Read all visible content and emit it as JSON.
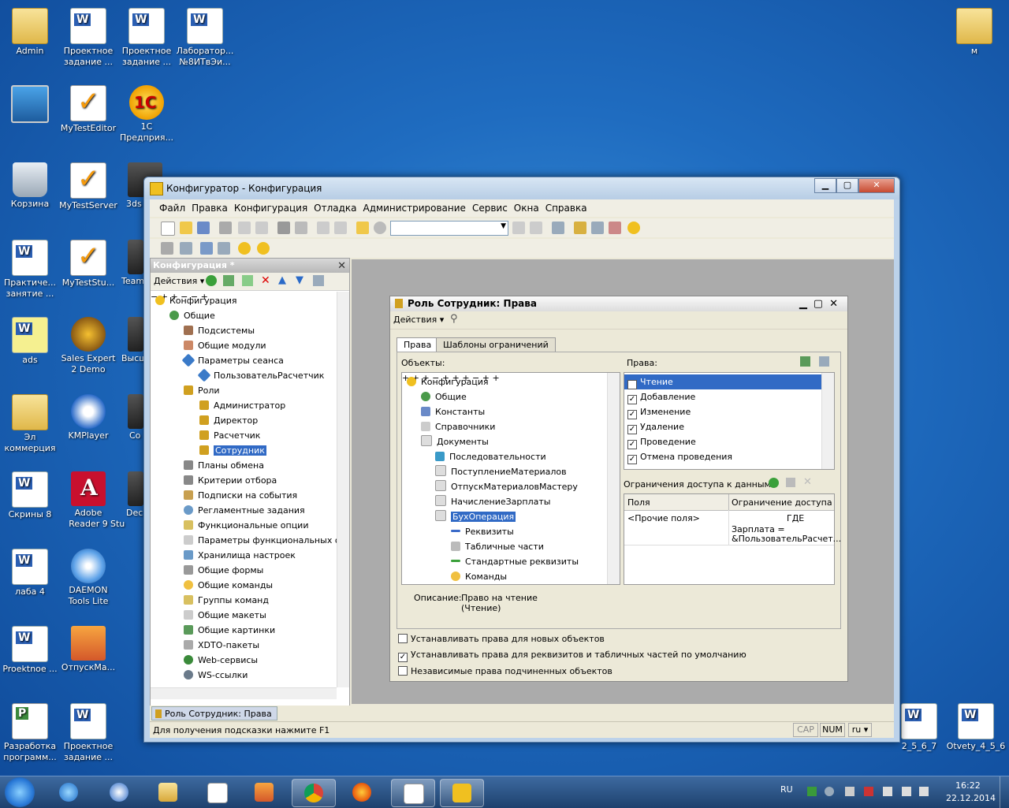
{
  "desktop": {
    "icons": [
      {
        "label": "Admin"
      },
      {
        "label": "Проектное задание ..."
      },
      {
        "label": "Проектное задание ..."
      },
      {
        "label": "Лаборатор... №8ИТвЭи..."
      },
      {
        "label": "м"
      },
      {
        "label": "MyTestEditor"
      },
      {
        "label": "1С Предприя..."
      },
      {
        "label": "Корзина"
      },
      {
        "label": "MyTestServer"
      },
      {
        "label": "3ds"
      },
      {
        "label": "Практиче... занятие ..."
      },
      {
        "label": "MyTestStu..."
      },
      {
        "label": "Team"
      },
      {
        "label": "ads"
      },
      {
        "label": "Sales Expert 2 Demo"
      },
      {
        "label": "Высш"
      },
      {
        "label": "Эл коммерция"
      },
      {
        "label": "KMPlayer"
      },
      {
        "label": "Co"
      },
      {
        "label": "Скрины 8"
      },
      {
        "label": "Adobe Reader 9"
      },
      {
        "label": "Dec Stu"
      },
      {
        "label": "лаба 4"
      },
      {
        "label": "DAEMON Tools Lite"
      },
      {
        "label": "Proektnoe ..."
      },
      {
        "label": "ОтпускМа..."
      },
      {
        "label": "Разработка программ..."
      },
      {
        "label": "Проектное задание ..."
      },
      {
        "label": "2_5_6_7"
      },
      {
        "label": "Otvety_4_5_6"
      }
    ]
  },
  "window": {
    "title": "Конфигуратор - Конфигурация",
    "menu": [
      "Файл",
      "Правка",
      "Конфигурация",
      "Отладка",
      "Администрирование",
      "Сервис",
      "Окна",
      "Справка"
    ]
  },
  "config_panel": {
    "title": "Конфигурация *",
    "actions_label": "Действия",
    "tree": [
      {
        "label": "Конфигурация"
      },
      {
        "label": "Общие"
      },
      {
        "label": "Подсистемы"
      },
      {
        "label": "Общие модули"
      },
      {
        "label": "Параметры сеанса"
      },
      {
        "label": "ПользовательРасчетчик"
      },
      {
        "label": "Роли"
      },
      {
        "label": "Администратор"
      },
      {
        "label": "Директор"
      },
      {
        "label": "Расчетчик"
      },
      {
        "label": "Сотрудник"
      },
      {
        "label": "Планы обмена"
      },
      {
        "label": "Критерии отбора"
      },
      {
        "label": "Подписки на события"
      },
      {
        "label": "Регламентные задания"
      },
      {
        "label": "Функциональные опции"
      },
      {
        "label": "Параметры функциональных опц"
      },
      {
        "label": "Хранилища настроек"
      },
      {
        "label": "Общие формы"
      },
      {
        "label": "Общие команды"
      },
      {
        "label": "Группы команд"
      },
      {
        "label": "Общие макеты"
      },
      {
        "label": "Общие картинки"
      },
      {
        "label": "XDTO-пакеты"
      },
      {
        "label": "Web-сервисы"
      },
      {
        "label": "WS-ссылки"
      }
    ]
  },
  "role_window": {
    "title": "Роль Сотрудник: Права",
    "actions_label": "Действия",
    "tabs": [
      {
        "label": "Права"
      },
      {
        "label": "Шаблоны ограничений"
      }
    ],
    "objects_label": "Объекты:",
    "rights_label": "Права:",
    "objects": [
      {
        "label": "Конфигурация"
      },
      {
        "label": "Общие"
      },
      {
        "label": "Константы"
      },
      {
        "label": "Справочники"
      },
      {
        "label": "Документы"
      },
      {
        "label": "Последовательности"
      },
      {
        "label": "ПоступлениеМатериалов"
      },
      {
        "label": "ОтпускМатериаловМастеру"
      },
      {
        "label": "НачислениеЗарплаты"
      },
      {
        "label": "БухОперация"
      },
      {
        "label": "Реквизиты"
      },
      {
        "label": "Табличные части"
      },
      {
        "label": "Стандартные реквизиты"
      },
      {
        "label": "Команды"
      }
    ],
    "rights": [
      {
        "label": "Чтение"
      },
      {
        "label": "Добавление"
      },
      {
        "label": "Изменение"
      },
      {
        "label": "Удаление"
      },
      {
        "label": "Проведение"
      },
      {
        "label": "Отмена проведения"
      }
    ],
    "restrictions_label": "Ограничения доступа к данным:",
    "restrictions_columns": [
      "Поля",
      "Ограничение доступа"
    ],
    "restriction_row": {
      "field": "<Прочие поля>",
      "restriction_line1": "ГДЕ",
      "restriction_line2": "Зарплата =",
      "restriction_line3": "&ПользовательРасчет..."
    },
    "description_label": "Описание:",
    "description_line1": "Право на чтение",
    "description_line2": "(Чтение)",
    "options": [
      {
        "label": "Устанавливать права для новых объектов"
      },
      {
        "label": "Устанавливать права для реквизитов и табличных частей по умолчанию"
      },
      {
        "label": "Независимые права подчиненных объектов"
      }
    ]
  },
  "window_tab": {
    "label": "Роль Сотрудник: Права"
  },
  "statusbar": {
    "hint": "Для получения подсказки нажмите F1",
    "cap": "CAP",
    "num": "NUM",
    "lang": "ru"
  },
  "taskbar": {
    "lang": "RU",
    "time": "16:22",
    "date": "22.12.2014"
  },
  "colors": {
    "selection": "#316ac5",
    "window_frame": "#bcd2ea"
  }
}
